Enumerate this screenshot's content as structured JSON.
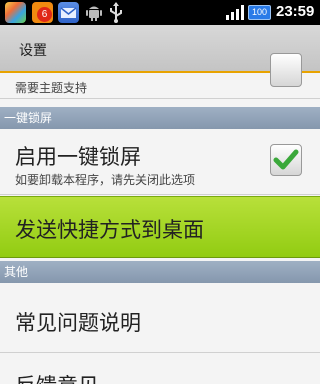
{
  "status_bar": {
    "notification_count": "6",
    "battery": "100",
    "time": "23:59",
    "icons": [
      "app-icon",
      "notification-app-icon",
      "mail-icon",
      "android-debug-icon",
      "usb-icon",
      "signal-icon",
      "battery-icon"
    ]
  },
  "title_bar": {
    "title": "设置"
  },
  "list": {
    "partial_row": {
      "subtitle": "需要主题支持"
    },
    "section_lockscreen": "一键锁屏",
    "lockscreen_row": {
      "title": "启用一键锁屏",
      "subtitle": "如要卸载本程序，请先关闭此选项",
      "checked": true
    },
    "shortcut_row": {
      "title": "发送快捷方式到桌面"
    },
    "section_other": "其他",
    "faq_row": {
      "title": "常见问题说明"
    },
    "feedback_row": {
      "title": "反馈意见"
    }
  },
  "colors": {
    "status_bar_bg": "#000000",
    "title_underline": "#e8a300",
    "section_bg": "#8f9fb4",
    "highlight_green": "#9acf1a",
    "check_green": "#3aa83a"
  }
}
